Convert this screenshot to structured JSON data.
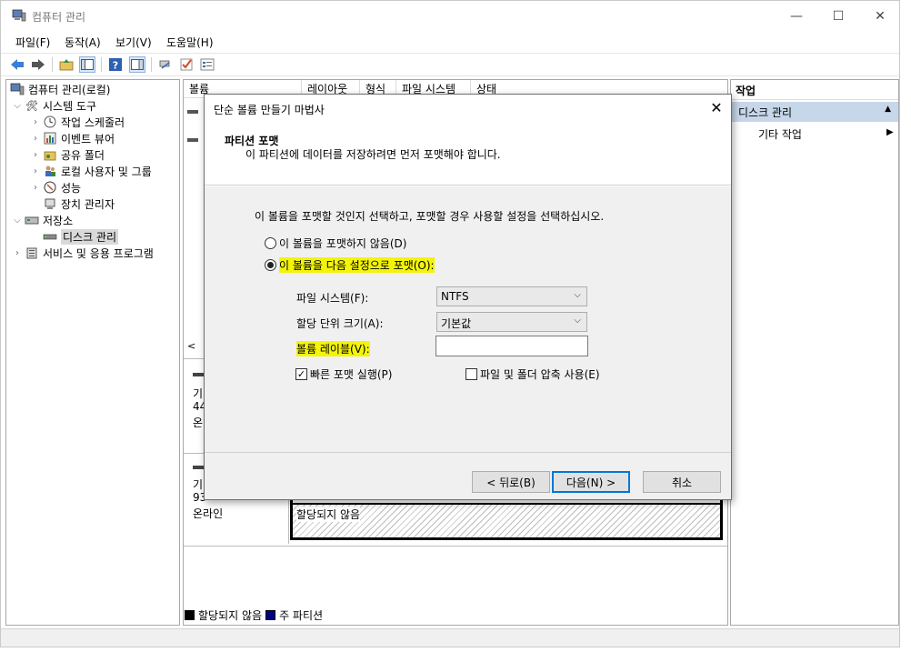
{
  "window": {
    "title": "컴퓨터 관리",
    "minimize": "—",
    "maximize": "☐",
    "close": "✕"
  },
  "menu": [
    "파일(F)",
    "동작(A)",
    "보기(V)",
    "도움말(H)"
  ],
  "tree": {
    "root": "컴퓨터 관리(로컬)",
    "system_tools": "시스템 도구",
    "task_scheduler": "작업 스케줄러",
    "event_viewer": "이벤트 뷰어",
    "shared_folders": "공유 폴더",
    "local_users": "로컬 사용자 및 그룹",
    "performance": "성능",
    "device_manager": "장치 관리자",
    "storage": "저장소",
    "disk_management": "디스크 관리",
    "services": "서비스 및 응용 프로그램"
  },
  "columns": [
    "볼륨",
    "레이아웃",
    "형식",
    "파일 시스템",
    "상태"
  ],
  "disks": {
    "disk1": {
      "line1": "기",
      "line2": "44",
      "line3": "온"
    },
    "disk2": {
      "line1": "기",
      "line2": "93",
      "line3": "온라인"
    },
    "unallocated_label": "할당되지 않음"
  },
  "legend": {
    "unallocated": "할당되지 않음",
    "primary": "주 파티션"
  },
  "actions": {
    "header": "작업",
    "selected": "디스크 관리",
    "more": "기타 작업"
  },
  "dialog": {
    "title": "단순 볼륨 만들기 마법사",
    "heading": "파티션 포맷",
    "subheading": "이 파티션에 데이터를 저장하려면 먼저 포맷해야 합니다.",
    "instruction": "이 볼륨을 포맷할 것인지 선택하고, 포맷할 경우 사용할 설정을 선택하십시오.",
    "radio_no_format": "이 볼륨을 포맷하지 않음(D)",
    "radio_format": "이 볼륨을 다음 설정으로 포맷(O):",
    "fs_label": "파일 시스템(F):",
    "fs_value": "NTFS",
    "alloc_label": "할당 단위 크기(A):",
    "alloc_value": "기본값",
    "volume_label": "볼륨 레이블(V):",
    "volume_value": "",
    "quick_format": "빠른 포맷 실행(P)",
    "compression": "파일 및 폴더 압축 사용(E)",
    "back_button": "< 뒤로(B)",
    "next_button": "다음(N) >",
    "cancel_button": "취소"
  },
  "colors": {
    "highlight": "#f4f40a",
    "primary_partition": "#000080",
    "selected_action": "#c7d7ea",
    "default_button_border": "#0078d7"
  }
}
